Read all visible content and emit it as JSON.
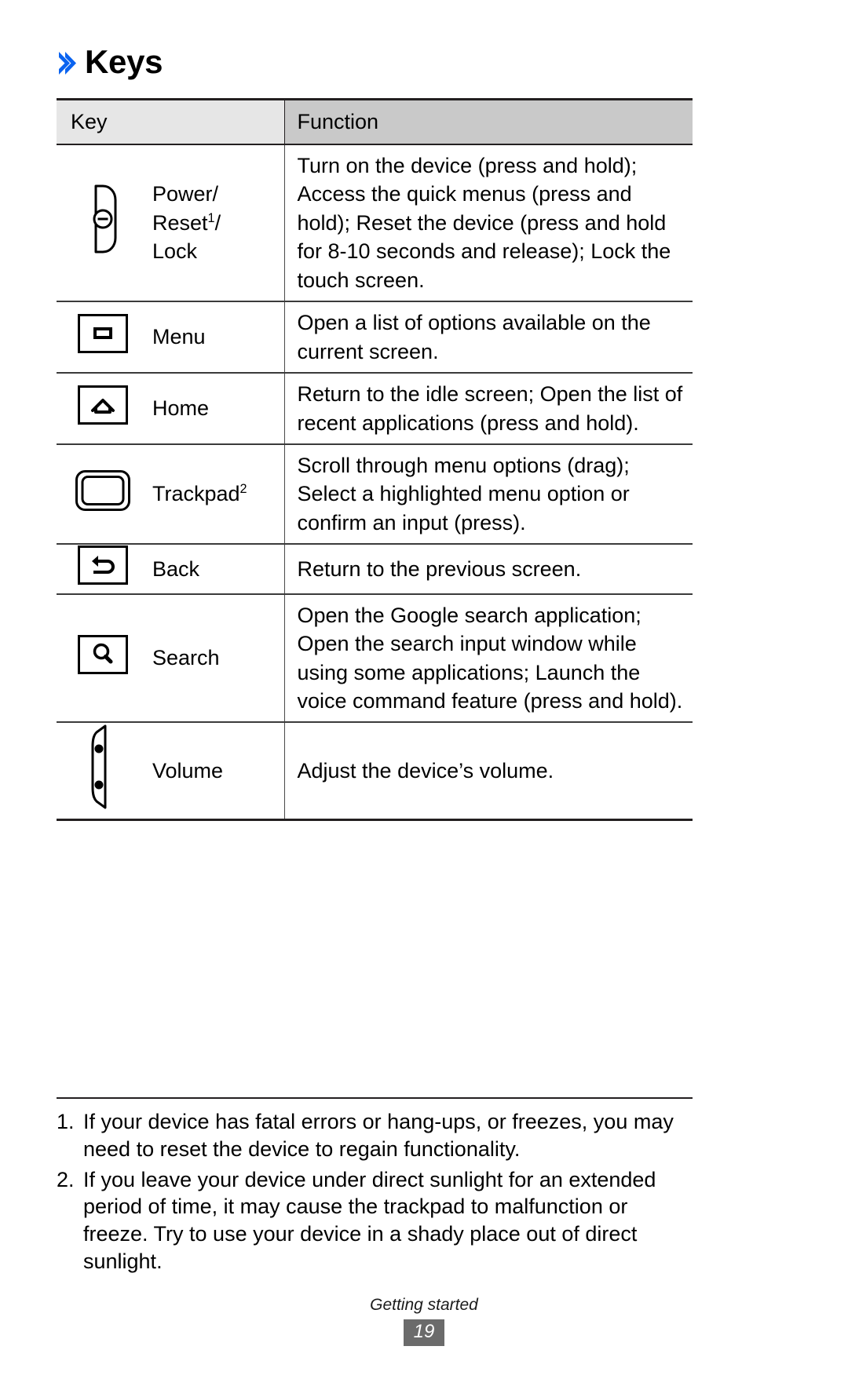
{
  "heading": {
    "chevron_icon": "chevron-right-icon",
    "title": "Keys"
  },
  "table": {
    "columns": [
      "Key",
      "Function"
    ],
    "rows": [
      {
        "icon": "power-key-icon",
        "label_parts": {
          "line1": "Power/",
          "line2_base": "Reset",
          "line2_sup": "1",
          "line2_tail": "/",
          "line3": "Lock"
        },
        "label_plain": "Power/ Reset1/ Lock",
        "function": "Turn on the device (press and hold); Access the quick menus (press and hold); Reset the device (press and hold for 8-10 seconds and release); Lock the touch screen."
      },
      {
        "icon": "menu-key-icon",
        "label_plain": "Menu",
        "function": "Open a list of options available on the current screen."
      },
      {
        "icon": "home-key-icon",
        "label_plain": "Home",
        "function": "Return to the idle screen; Open the list of recent applications (press and hold)."
      },
      {
        "icon": "trackpad-key-icon",
        "label_parts": {
          "base": "Trackpad",
          "sup": "2"
        },
        "label_plain": "Trackpad2",
        "function": "Scroll through menu options (drag); Select a highlighted menu option or confirm an input (press)."
      },
      {
        "icon": "back-key-icon",
        "label_plain": "Back",
        "function": "Return to the previous screen."
      },
      {
        "icon": "search-key-icon",
        "label_plain": "Search",
        "function": "Open the Google search application; Open the search input window while using some applications; Launch the voice command feature (press and hold)."
      },
      {
        "icon": "volume-key-icon",
        "label_plain": "Volume",
        "function": "Adjust the device’s volume."
      }
    ]
  },
  "footnotes": [
    {
      "number": "1.",
      "text": "If your device has fatal errors or hang-ups, or freezes, you may need to reset the device to regain functionality."
    },
    {
      "number": "2.",
      "text": "If you leave your device under direct sunlight for an extended period of time, it may cause the trackpad to malfunction or freeze. Try to use your device in a shady place out of direct sunlight."
    }
  ],
  "footer": {
    "chapter": "Getting started",
    "page_number": "19"
  },
  "colors": {
    "accent": "#0a63f0",
    "header_key_bg": "#e6e6e6",
    "header_func_bg": "#c9c9c9",
    "page_badge_bg": "#6b6b6b",
    "rule": "#231f20"
  }
}
